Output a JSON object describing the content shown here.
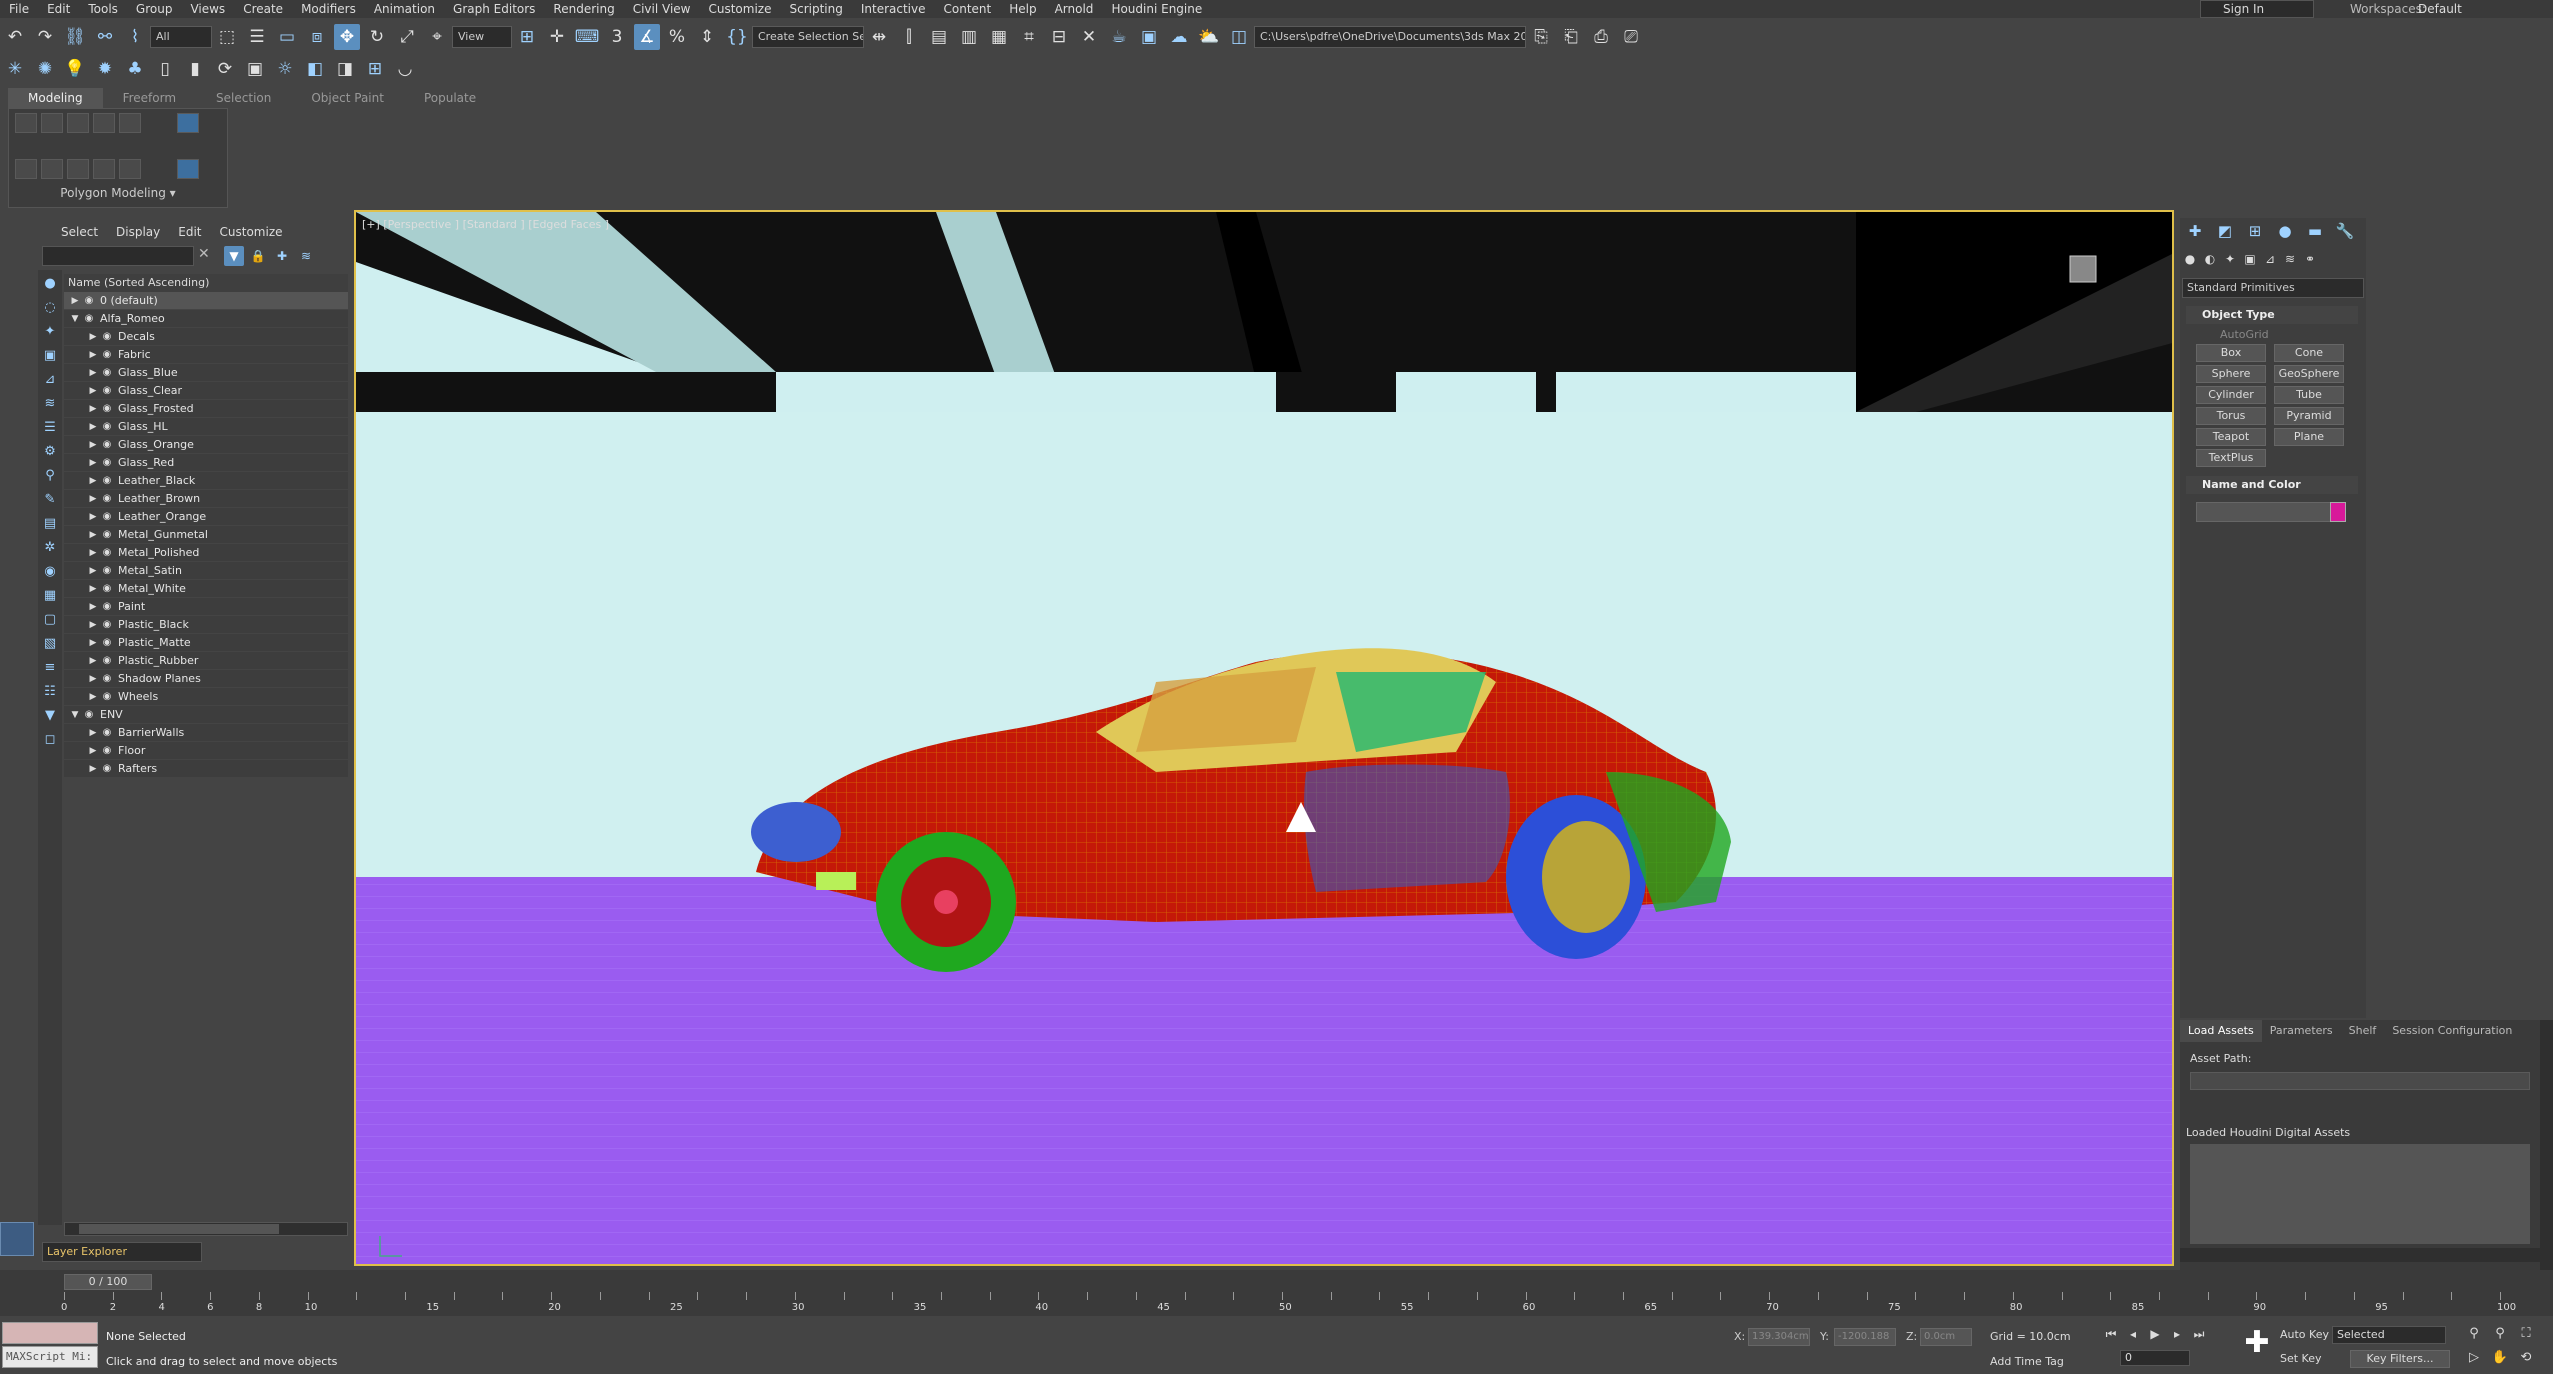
{
  "menubar": {
    "items": [
      "File",
      "Edit",
      "Tools",
      "Group",
      "Views",
      "Create",
      "Modifiers",
      "Animation",
      "Graph Editors",
      "Rendering",
      "Civil View",
      "Customize",
      "Scripting",
      "Interactive",
      "Content",
      "Help",
      "Arnold",
      "Houdini Engine"
    ],
    "sign_in": "Sign In",
    "workspaces_label": "Workspaces:",
    "workspaces_value": "Default"
  },
  "toolbar": {
    "filter_value": "All",
    "refcoord_value": "View",
    "selection_set_placeholder": "Create Selection Se",
    "project_path": "C:\\Users\\pdfre\\OneDrive\\Documents\\3ds Max 2020"
  },
  "ribbon": {
    "tabs": [
      "Modeling",
      "Freeform",
      "Selection",
      "Object Paint",
      "Populate"
    ],
    "panel_label": "Polygon Modeling"
  },
  "scene_explorer": {
    "menu": [
      "Select",
      "Display",
      "Edit",
      "Customize"
    ],
    "column_header": "Name (Sorted Ascending)",
    "layers": [
      {
        "name": "0 (default)",
        "level": 0,
        "expanded": false,
        "selected": true
      },
      {
        "name": "Alfa_Romeo",
        "level": 0,
        "expanded": true
      },
      {
        "name": "Decals",
        "level": 1
      },
      {
        "name": "Fabric",
        "level": 1
      },
      {
        "name": "Glass_Blue",
        "level": 1
      },
      {
        "name": "Glass_Clear",
        "level": 1
      },
      {
        "name": "Glass_Frosted",
        "level": 1
      },
      {
        "name": "Glass_HL",
        "level": 1
      },
      {
        "name": "Glass_Orange",
        "level": 1
      },
      {
        "name": "Glass_Red",
        "level": 1
      },
      {
        "name": "Leather_Black",
        "level": 1
      },
      {
        "name": "Leather_Brown",
        "level": 1
      },
      {
        "name": "Leather_Orange",
        "level": 1
      },
      {
        "name": "Metal_Gunmetal",
        "level": 1
      },
      {
        "name": "Metal_Polished",
        "level": 1
      },
      {
        "name": "Metal_Satin",
        "level": 1
      },
      {
        "name": "Metal_White",
        "level": 1
      },
      {
        "name": "Paint",
        "level": 1
      },
      {
        "name": "Plastic_Black",
        "level": 1
      },
      {
        "name": "Plastic_Matte",
        "level": 1
      },
      {
        "name": "Plastic_Rubber",
        "level": 1
      },
      {
        "name": "Shadow Planes",
        "level": 1
      },
      {
        "name": "Wheels",
        "level": 1
      },
      {
        "name": "ENV",
        "level": 0,
        "expanded": true
      },
      {
        "name": "BarrierWalls",
        "level": 1
      },
      {
        "name": "Floor",
        "level": 1
      },
      {
        "name": "Rafters",
        "level": 1
      }
    ],
    "layer_explorer": "Layer Explorer"
  },
  "viewport": {
    "label": "[+] [Perspective ] [Standard ] [Edged Faces ]"
  },
  "command_panel": {
    "primitive_category": "Standard Primitives",
    "object_type_title": "Object Type",
    "autogrid": "AutoGrid",
    "buttons": [
      "Box",
      "Cone",
      "Sphere",
      "GeoSphere",
      "Cylinder",
      "Tube",
      "Torus",
      "Pyramid",
      "Teapot",
      "Plane",
      "TextPlus"
    ],
    "name_color_title": "Name and Color",
    "object_color": "#d8199a"
  },
  "houdini": {
    "tabs": [
      "Load Assets",
      "Parameters",
      "Shelf",
      "Session Configuration"
    ],
    "asset_path_label": "Asset Path:",
    "loaded_label": "Loaded Houdini Digital Assets"
  },
  "timeline": {
    "slider": "0 / 100",
    "ticks": [
      0,
      2,
      4,
      6,
      8,
      10,
      12,
      14,
      16,
      18,
      20,
      22,
      24,
      26,
      28,
      30,
      32,
      34,
      36,
      38,
      40,
      42,
      44,
      46,
      48,
      50,
      52,
      54,
      56,
      58,
      60,
      62,
      64,
      66,
      68,
      70,
      72,
      74,
      76,
      78,
      80,
      82,
      84,
      86,
      88,
      90,
      92,
      94,
      96,
      98,
      100
    ],
    "labeled": [
      0,
      2,
      4,
      6,
      8,
      10,
      15,
      20,
      25,
      30,
      35,
      40,
      45,
      50,
      55,
      60,
      65,
      70,
      75,
      80,
      85,
      90,
      95,
      100
    ]
  },
  "status": {
    "maxscript": "MAXScript Mi:",
    "selection": "None Selected",
    "prompt": "Click and drag to select and move objects",
    "x_label": "X:",
    "x_value": "139.304cm",
    "y_label": "Y:",
    "y_value": "-1200.188",
    "z_label": "Z:",
    "z_value": "0.0cm",
    "grid": "Grid = 10.0cm",
    "add_time_tag": "Add Time Tag",
    "frame": "0",
    "auto_key": "Auto Key",
    "set_key": "Set Key",
    "selected": "Selected",
    "key_filters": "Key Filters..."
  }
}
